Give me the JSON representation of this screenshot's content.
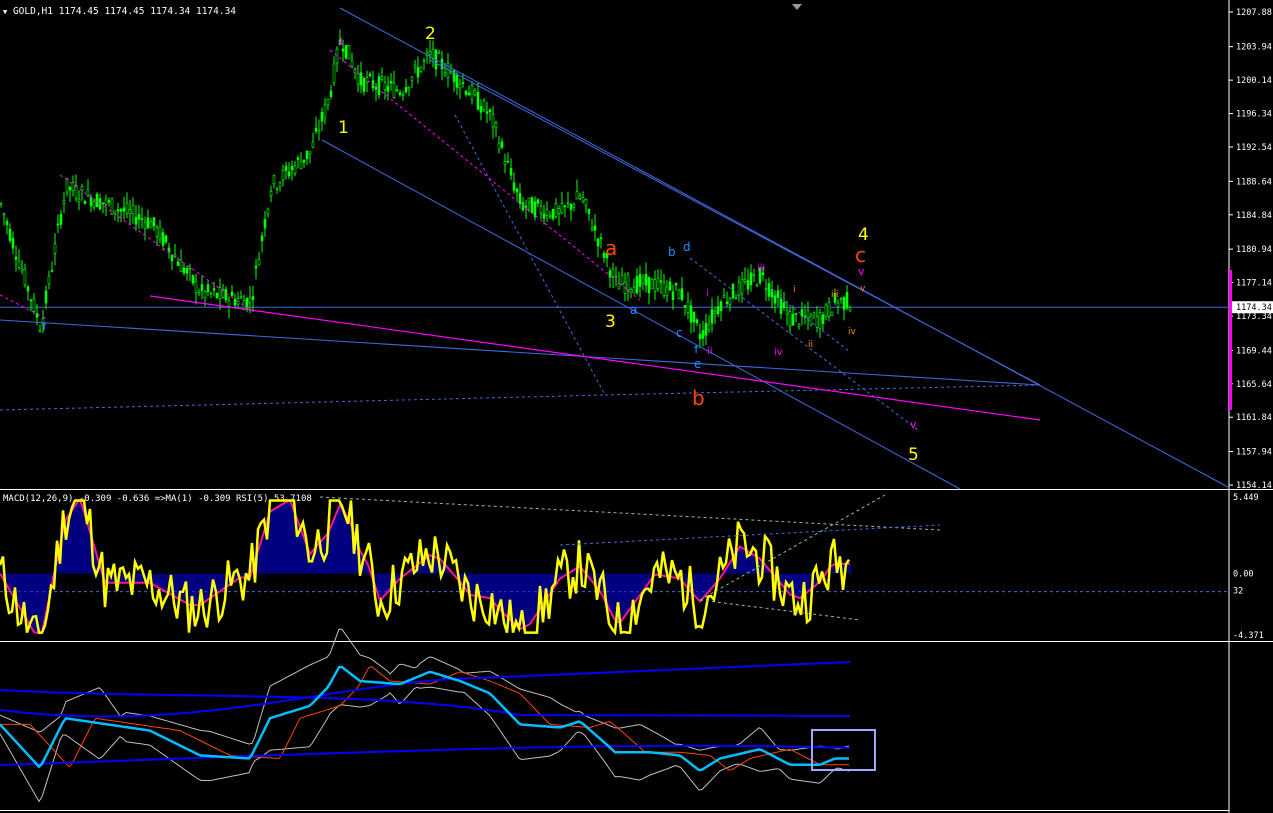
{
  "header": {
    "symbol_line": "GOLD,H1  1174.45 1174.45 1174.34 1174.34"
  },
  "chart_data": [
    {
      "type": "candlestick",
      "symbol": "GOLD",
      "timeframe": "H1",
      "ohlc": {
        "open": 1174.45,
        "high": 1174.45,
        "low": 1174.34,
        "close": 1174.34
      },
      "current_price_label": "1174.34",
      "ylim": [
        1154.14,
        1207.88
      ],
      "price_ticks": [
        "1207.88",
        "1203.94",
        "1200.14",
        "1196.34",
        "1192.54",
        "1188.64",
        "1184.84",
        "1180.94",
        "1177.14",
        "1173.34",
        "1169.44",
        "1165.64",
        "1161.84",
        "1157.94",
        "1154.14"
      ],
      "bars": 850,
      "trend_points": [
        [
          0,
          1186
        ],
        [
          40,
          1172
        ],
        [
          65,
          1188
        ],
        [
          150,
          1184
        ],
        [
          200,
          1176
        ],
        [
          250,
          1175
        ],
        [
          270,
          1188
        ],
        [
          310,
          1192
        ],
        [
          328,
          1198
        ],
        [
          340,
          1205
        ],
        [
          360,
          1200
        ],
        [
          400,
          1199
        ],
        [
          430,
          1203
        ],
        [
          460,
          1200
        ],
        [
          490,
          1196
        ],
        [
          520,
          1186
        ],
        [
          560,
          1185
        ],
        [
          580,
          1187
        ],
        [
          605,
          1180
        ],
        [
          615,
          1177
        ],
        [
          650,
          1177
        ],
        [
          680,
          1176
        ],
        [
          700,
          1171
        ],
        [
          720,
          1175
        ],
        [
          760,
          1178
        ],
        [
          790,
          1173
        ],
        [
          820,
          1173
        ],
        [
          835,
          1175
        ],
        [
          850,
          1175
        ]
      ],
      "wave_labels": [
        {
          "text": "1",
          "color": "#ffff00"
        },
        {
          "text": "2",
          "color": "#ffff00"
        },
        {
          "text": "3",
          "color": "#ffff00"
        },
        {
          "text": "4",
          "color": "#ffff00"
        },
        {
          "text": "5",
          "color": "#ffff00"
        },
        {
          "text": "a",
          "color": "#ff4500"
        },
        {
          "text": "b",
          "color": "#ff4500"
        },
        {
          "text": "c",
          "color": "#ff4500"
        },
        {
          "text": "a",
          "color": "#1e90ff"
        },
        {
          "text": "b",
          "color": "#1e90ff"
        },
        {
          "text": "c",
          "color": "#1e90ff"
        },
        {
          "text": "d",
          "color": "#1e90ff"
        },
        {
          "text": "e",
          "color": "#1e90ff"
        },
        {
          "text": "i",
          "color": "#ff00ff"
        },
        {
          "text": "ii",
          "color": "#ff00ff"
        },
        {
          "text": "iii",
          "color": "#ff00ff"
        },
        {
          "text": "iv",
          "color": "#ff00ff"
        },
        {
          "text": "v",
          "color": "#ff00ff"
        },
        {
          "text": "v",
          "color": "#ff00ff"
        },
        {
          "text": "i",
          "color": "#ff8c00"
        },
        {
          "text": "ii",
          "color": "#ff8c00"
        },
        {
          "text": "iii",
          "color": "#ff8c00"
        },
        {
          "text": "iv",
          "color": "#ff8c00"
        },
        {
          "text": "v",
          "color": "#ff8c00"
        }
      ],
      "colors": {
        "candles": "#00ff00",
        "channel": "#4169e1",
        "support": "#ff00ff",
        "price_line": "#4169e1"
      }
    },
    {
      "type": "macd_rsi",
      "label": "MACD(12,26,9) -0.309 -0.636  =>MA(1) -0.309  RSI(5) 53.7108",
      "ylim": [
        -4.371,
        5.449
      ],
      "axis_ticks": [
        "5.449",
        "0.00",
        "32",
        "-4.371"
      ],
      "colors": {
        "histogram": "#0000ff",
        "signal": "#ff1493",
        "rsi": "#ffff00"
      }
    },
    {
      "type": "line",
      "label": "",
      "colors": {
        "primary": "#00bfff",
        "bands": "#0000ff",
        "envelope": "#c0c0c0"
      }
    }
  ]
}
